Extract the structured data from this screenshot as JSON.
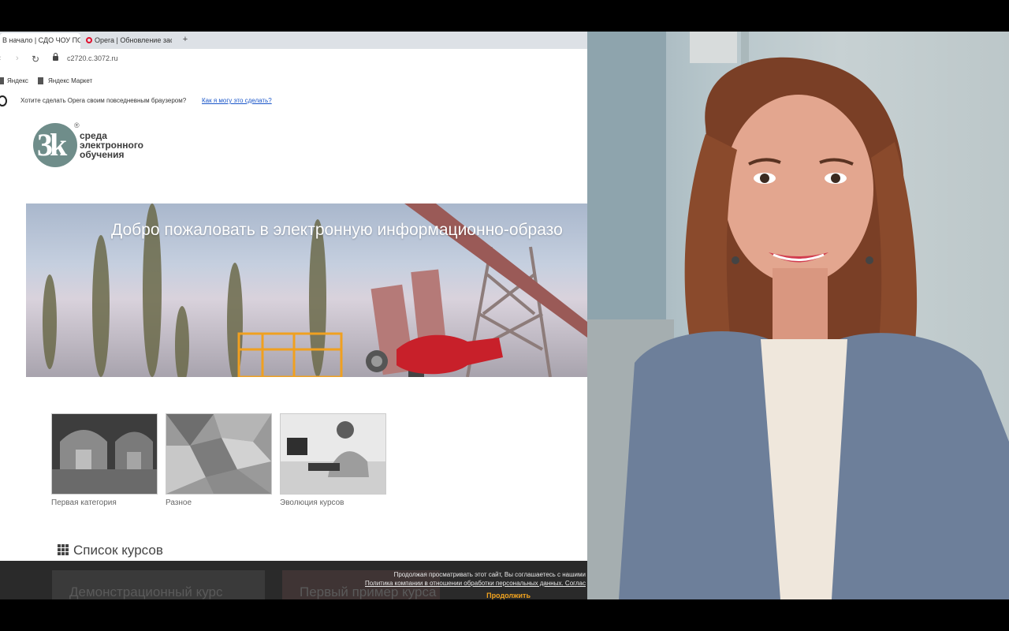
{
  "browser": {
    "tabs": [
      {
        "label": "В начало | СДО ЧОУ ПО"
      },
      {
        "label": "Opera | Обновление зас"
      }
    ],
    "new_tab": "+",
    "url": "c2720.c.3072.ru",
    "bookmarks": [
      "Яндекс",
      "Яндекс Маркет"
    ],
    "infobar": {
      "text": "Хотите сделать Opera своим повседневным браузером?",
      "link": "Как я могу это сделать?"
    }
  },
  "site": {
    "logo": {
      "mark": "3k",
      "lines": [
        "среда",
        "электронного",
        "обучения"
      ],
      "registered": "®"
    },
    "banner_title": "Добро пожаловать в электронную информационно-образо",
    "categories": [
      {
        "label": "Первая категория"
      },
      {
        "label": "Разное"
      },
      {
        "label": "Эволюция курсов"
      }
    ],
    "courses_heading": "Список курсов",
    "course_cards": [
      "Демонстрационный курс",
      "Первый пример курса"
    ],
    "cookie": {
      "text": "Продолжая просматривать этот сайт, Вы соглашаетесь с нашими",
      "link": "Политика компании в отношении обработки персональных данных. Соглас",
      "button": "Продолжить"
    }
  },
  "colors": {
    "logo": "#6f8d8a",
    "link": "#1a56c9",
    "cookie_button": "#f0a21e",
    "opera": "#e0102e"
  }
}
